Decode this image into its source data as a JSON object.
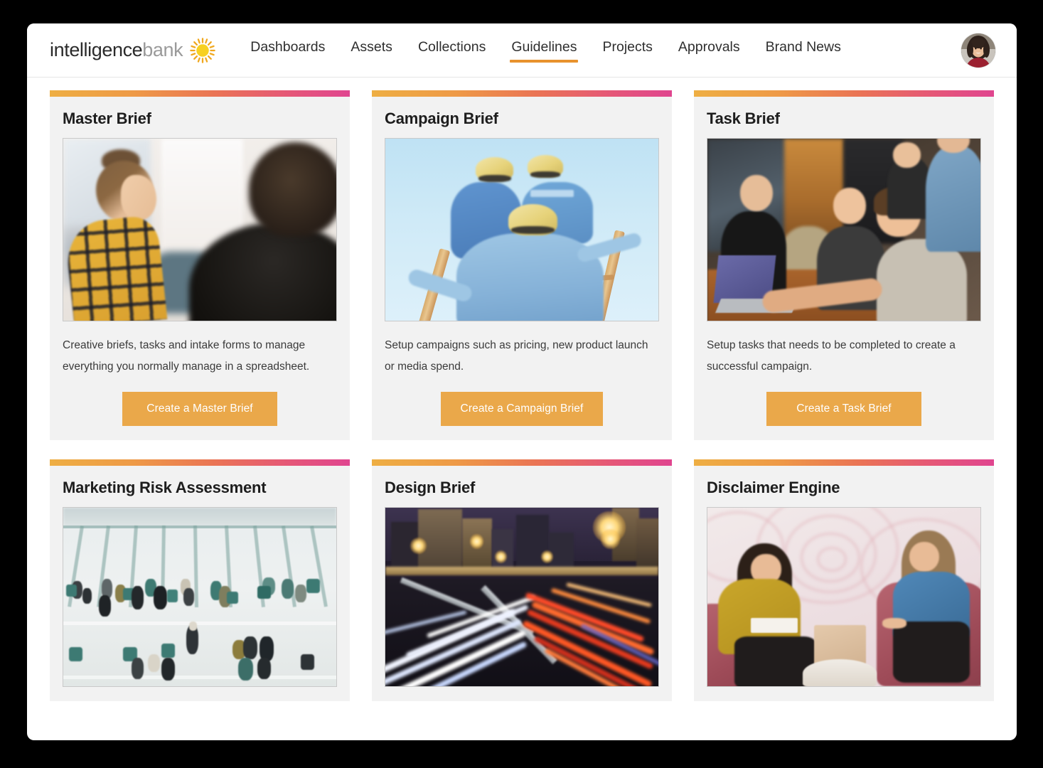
{
  "header": {
    "brand": {
      "name_part1": "intelligence",
      "name_part2": "bank",
      "logo_icon": "sun-icon"
    },
    "nav": [
      {
        "label": "Dashboards",
        "active": false
      },
      {
        "label": "Assets",
        "active": false
      },
      {
        "label": "Collections",
        "active": false
      },
      {
        "label": "Guidelines",
        "active": true
      },
      {
        "label": "Projects",
        "active": false
      },
      {
        "label": "Approvals",
        "active": false
      },
      {
        "label": "Brand News",
        "active": false
      }
    ],
    "avatar_name": "user-avatar"
  },
  "colors": {
    "accent_orange": "#e8922d",
    "button_orange": "#eaa84a",
    "gradient_start": "#eeae43",
    "gradient_end": "#e0458f",
    "card_background": "#f2f2f2",
    "page_background": "#ffffff"
  },
  "cards": [
    {
      "title": "Master Brief",
      "image_name": "meeting-plaid-photo",
      "description": "Creative briefs, tasks and intake forms to manage everything you normally manage in a spreadsheet.",
      "cta": "Create a Master Brief"
    },
    {
      "title": "Campaign Brief",
      "image_name": "construction-workers-photo",
      "description": "Setup campaigns such as pricing, new product launch or media spend.",
      "cta": "Create a Campaign Brief"
    },
    {
      "title": "Task Brief",
      "image_name": "office-team-photo",
      "description": "Setup tasks that needs to be completed to create a successful campaign.",
      "cta": "Create a Task Brief"
    },
    {
      "title": "Marketing Risk Assessment",
      "image_name": "atrium-aerial-photo",
      "description": "",
      "cta": ""
    },
    {
      "title": "Design Brief",
      "image_name": "night-traffic-photo",
      "description": "",
      "cta": ""
    },
    {
      "title": "Disclaimer Engine",
      "image_name": "lounge-women-photo",
      "description": "",
      "cta": ""
    }
  ]
}
